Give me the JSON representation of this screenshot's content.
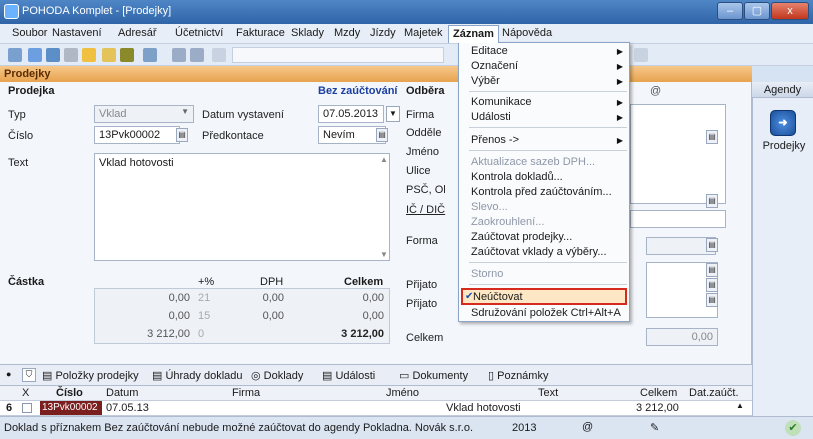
{
  "window": {
    "title": "POHODA Komplet - [Prodejky]",
    "min": "–",
    "max": "▢",
    "close": "x"
  },
  "menu": [
    {
      "label": "Soubor"
    },
    {
      "label": "Nastavení"
    },
    {
      "label": "Adresář"
    },
    {
      "label": "Účetnictví"
    },
    {
      "label": "Fakturace"
    },
    {
      "label": "Sklady"
    },
    {
      "label": "Mzdy"
    },
    {
      "label": "Jízdy"
    },
    {
      "label": "Majetek"
    },
    {
      "label": "Záznam"
    },
    {
      "label": "Nápověda"
    }
  ],
  "agenda_title": "Prodejky",
  "form": {
    "section_title": "Prodejka",
    "status": "Bez zaúčtování",
    "typ_label": "Typ",
    "typ_value": "Vklad",
    "datum_label": "Datum vystavení",
    "datum_value": "07.05.2013",
    "cislo_label": "Číslo",
    "cislo_value": "13Pvk00002",
    "predkontace_label": "Předkontace",
    "predkontace_value": "Nevím",
    "text_label": "Text",
    "text_value": "Vklad hotovosti",
    "odberatel_label": "Odběra",
    "firma_label": "Firma",
    "oddeleni_label": "Odděle",
    "jmeno_label": "Jméno",
    "ulice_label": "Ulice",
    "psc_label": "PSČ, Ol",
    "ic_label": "IČ / DIČ",
    "forma_label": "Forma",
    "prijato1_label": "Přijato",
    "prijato2_label": "Přijato",
    "celkem_label": "Celkem",
    "celkem_right_value": "0,00",
    "at_sign": "@"
  },
  "amounts": {
    "castka_label": "Částka",
    "pct_label": "+%",
    "dph_label": "DPH",
    "celkem_label": "Celkem",
    "rows": [
      {
        "base": "0,00",
        "pct": "21",
        "dph": "0,00",
        "total": "0,00"
      },
      {
        "base": "0,00",
        "pct": "15",
        "dph": "0,00",
        "total": "0,00"
      },
      {
        "base": "3 212,00",
        "pct": "0",
        "dph": "",
        "total": "3 212,00"
      }
    ]
  },
  "dropdown": {
    "items": [
      {
        "label": "Editace",
        "submenu": true,
        "disabled": false
      },
      {
        "label": "Označení",
        "submenu": true,
        "disabled": false
      },
      {
        "label": "Výběr",
        "submenu": true,
        "disabled": false
      },
      {
        "label": "Komunikace",
        "submenu": true,
        "disabled": false
      },
      {
        "label": "Události",
        "submenu": true,
        "disabled": false
      },
      {
        "label": "Přenos ->",
        "submenu": true,
        "disabled": false
      },
      {
        "label": "Aktualizace sazeb DPH...",
        "submenu": false,
        "disabled": true
      },
      {
        "label": "Kontrola dokladů...",
        "submenu": false,
        "disabled": false
      },
      {
        "label": "Kontrola před zaúčtováním...",
        "submenu": false,
        "disabled": false
      },
      {
        "label": "Slevo...",
        "submenu": false,
        "disabled": true
      },
      {
        "label": "Zaokrouhlení...",
        "submenu": false,
        "disabled": true
      },
      {
        "label": "Zaúčtovat prodejky...",
        "submenu": false,
        "disabled": false
      },
      {
        "label": "Zaúčtovat vklady a výběry...",
        "submenu": false,
        "disabled": false
      },
      {
        "label": "Storno",
        "submenu": false,
        "disabled": true
      },
      {
        "label": "Neúčtovat",
        "submenu": false,
        "disabled": false,
        "checked": true,
        "highlighted": true
      },
      {
        "label": "Sdružování položek  Ctrl+Alt+A",
        "submenu": false,
        "disabled": false
      }
    ]
  },
  "agendy": {
    "title": "Agendy",
    "item": "Prodejky"
  },
  "tabs": [
    {
      "label": "Položky prodejky"
    },
    {
      "label": "Úhrady dokladu"
    },
    {
      "label": "Doklady"
    },
    {
      "label": "Události"
    },
    {
      "label": "Dokumenty"
    },
    {
      "label": "Poznámky"
    }
  ],
  "grid": {
    "headers": [
      "X",
      "Číslo",
      "Datum",
      "Firma",
      "Jméno",
      "Text",
      "Celkem",
      "Dat.zaúčt."
    ],
    "row": {
      "index": "6",
      "cislo": "13Pvk00002",
      "datum": "07.05.13",
      "firma": "",
      "jmeno": "",
      "text": "Vklad hotovosti",
      "celkem": "3 212,00",
      "datzauct": ""
    }
  },
  "status": {
    "message": "Doklad s příznakem Bez zaúčtování nebude možné zaúčtovat do agendy Pokladna.  Novák s.r.o.",
    "year": "2013"
  }
}
